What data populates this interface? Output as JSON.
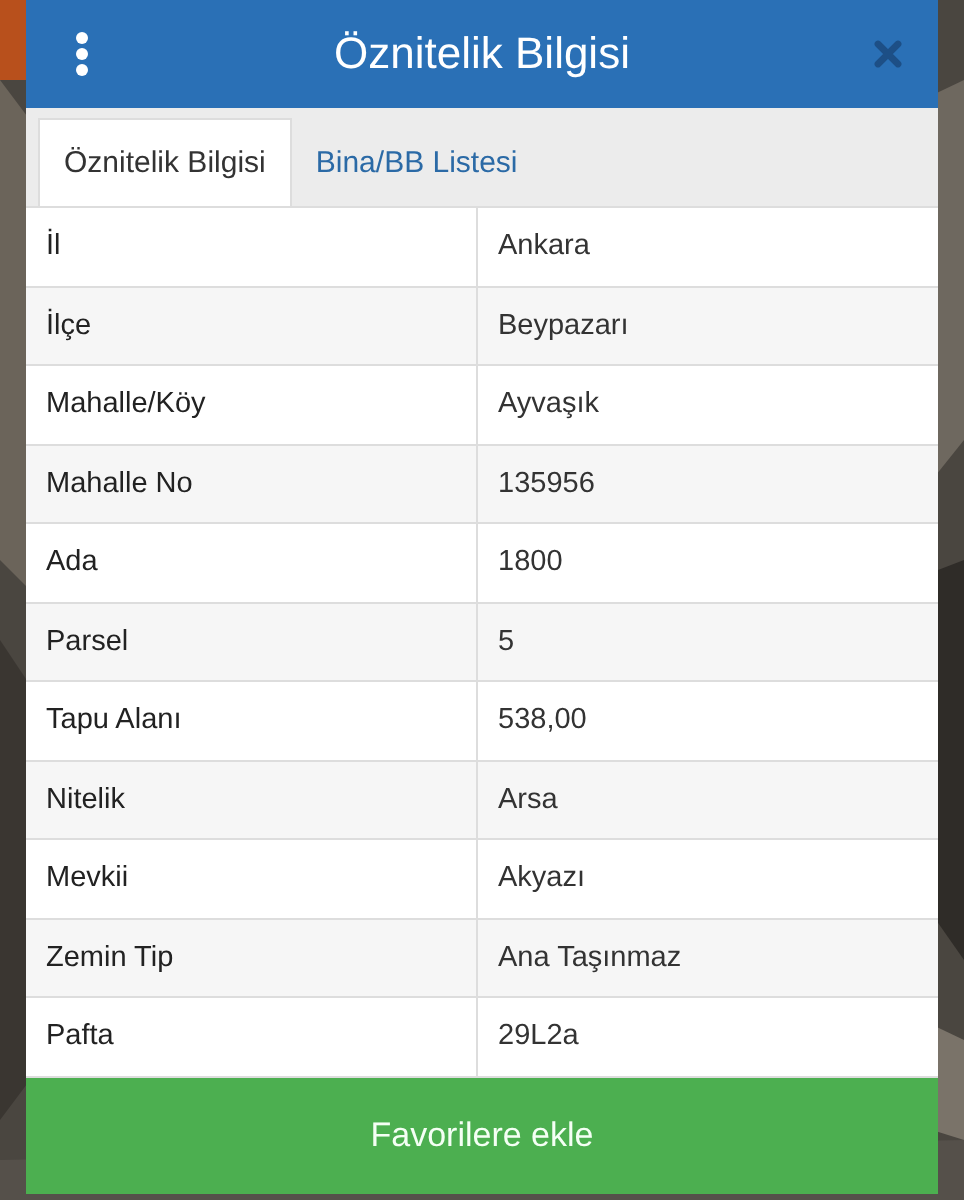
{
  "dialog": {
    "title": "Öznitelik Bilgisi"
  },
  "tabs": [
    {
      "label": "Öznitelik Bilgisi",
      "selected": true
    },
    {
      "label": "Bina/BB Listesi",
      "selected": false
    }
  ],
  "rows": [
    {
      "label": "İl",
      "value": "Ankara"
    },
    {
      "label": "İlçe",
      "value": "Beypazarı"
    },
    {
      "label": "Mahalle/Köy",
      "value": "Ayvaşık"
    },
    {
      "label": "Mahalle No",
      "value": "135956"
    },
    {
      "label": "Ada",
      "value": "1800"
    },
    {
      "label": "Parsel",
      "value": "5"
    },
    {
      "label": "Tapu Alanı",
      "value": "538,00"
    },
    {
      "label": "Nitelik",
      "value": "Arsa"
    },
    {
      "label": "Mevkii",
      "value": "Akyazı"
    },
    {
      "label": "Zemin Tip",
      "value": "Ana Taşınmaz"
    },
    {
      "label": "Pafta",
      "value": "29L2a"
    }
  ],
  "button": {
    "label": "Favorilere ekle"
  }
}
